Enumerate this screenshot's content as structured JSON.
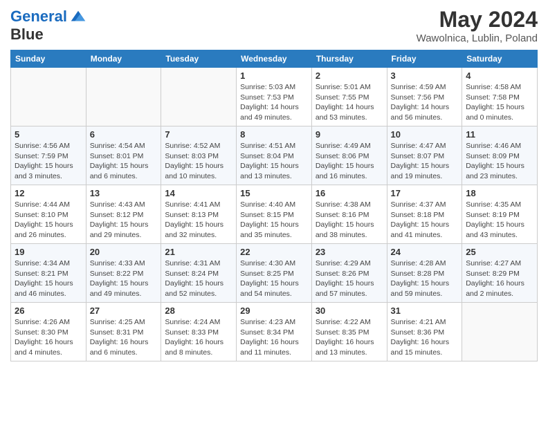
{
  "header": {
    "logo_line1": "General",
    "logo_line2": "Blue",
    "month": "May 2024",
    "location": "Wawolnica, Lublin, Poland"
  },
  "weekdays": [
    "Sunday",
    "Monday",
    "Tuesday",
    "Wednesday",
    "Thursday",
    "Friday",
    "Saturday"
  ],
  "weeks": [
    [
      {
        "day": "",
        "info": ""
      },
      {
        "day": "",
        "info": ""
      },
      {
        "day": "",
        "info": ""
      },
      {
        "day": "1",
        "info": "Sunrise: 5:03 AM\nSunset: 7:53 PM\nDaylight: 14 hours and 49 minutes."
      },
      {
        "day": "2",
        "info": "Sunrise: 5:01 AM\nSunset: 7:55 PM\nDaylight: 14 hours and 53 minutes."
      },
      {
        "day": "3",
        "info": "Sunrise: 4:59 AM\nSunset: 7:56 PM\nDaylight: 14 hours and 56 minutes."
      },
      {
        "day": "4",
        "info": "Sunrise: 4:58 AM\nSunset: 7:58 PM\nDaylight: 15 hours and 0 minutes."
      }
    ],
    [
      {
        "day": "5",
        "info": "Sunrise: 4:56 AM\nSunset: 7:59 PM\nDaylight: 15 hours and 3 minutes."
      },
      {
        "day": "6",
        "info": "Sunrise: 4:54 AM\nSunset: 8:01 PM\nDaylight: 15 hours and 6 minutes."
      },
      {
        "day": "7",
        "info": "Sunrise: 4:52 AM\nSunset: 8:03 PM\nDaylight: 15 hours and 10 minutes."
      },
      {
        "day": "8",
        "info": "Sunrise: 4:51 AM\nSunset: 8:04 PM\nDaylight: 15 hours and 13 minutes."
      },
      {
        "day": "9",
        "info": "Sunrise: 4:49 AM\nSunset: 8:06 PM\nDaylight: 15 hours and 16 minutes."
      },
      {
        "day": "10",
        "info": "Sunrise: 4:47 AM\nSunset: 8:07 PM\nDaylight: 15 hours and 19 minutes."
      },
      {
        "day": "11",
        "info": "Sunrise: 4:46 AM\nSunset: 8:09 PM\nDaylight: 15 hours and 23 minutes."
      }
    ],
    [
      {
        "day": "12",
        "info": "Sunrise: 4:44 AM\nSunset: 8:10 PM\nDaylight: 15 hours and 26 minutes."
      },
      {
        "day": "13",
        "info": "Sunrise: 4:43 AM\nSunset: 8:12 PM\nDaylight: 15 hours and 29 minutes."
      },
      {
        "day": "14",
        "info": "Sunrise: 4:41 AM\nSunset: 8:13 PM\nDaylight: 15 hours and 32 minutes."
      },
      {
        "day": "15",
        "info": "Sunrise: 4:40 AM\nSunset: 8:15 PM\nDaylight: 15 hours and 35 minutes."
      },
      {
        "day": "16",
        "info": "Sunrise: 4:38 AM\nSunset: 8:16 PM\nDaylight: 15 hours and 38 minutes."
      },
      {
        "day": "17",
        "info": "Sunrise: 4:37 AM\nSunset: 8:18 PM\nDaylight: 15 hours and 41 minutes."
      },
      {
        "day": "18",
        "info": "Sunrise: 4:35 AM\nSunset: 8:19 PM\nDaylight: 15 hours and 43 minutes."
      }
    ],
    [
      {
        "day": "19",
        "info": "Sunrise: 4:34 AM\nSunset: 8:21 PM\nDaylight: 15 hours and 46 minutes."
      },
      {
        "day": "20",
        "info": "Sunrise: 4:33 AM\nSunset: 8:22 PM\nDaylight: 15 hours and 49 minutes."
      },
      {
        "day": "21",
        "info": "Sunrise: 4:31 AM\nSunset: 8:24 PM\nDaylight: 15 hours and 52 minutes."
      },
      {
        "day": "22",
        "info": "Sunrise: 4:30 AM\nSunset: 8:25 PM\nDaylight: 15 hours and 54 minutes."
      },
      {
        "day": "23",
        "info": "Sunrise: 4:29 AM\nSunset: 8:26 PM\nDaylight: 15 hours and 57 minutes."
      },
      {
        "day": "24",
        "info": "Sunrise: 4:28 AM\nSunset: 8:28 PM\nDaylight: 15 hours and 59 minutes."
      },
      {
        "day": "25",
        "info": "Sunrise: 4:27 AM\nSunset: 8:29 PM\nDaylight: 16 hours and 2 minutes."
      }
    ],
    [
      {
        "day": "26",
        "info": "Sunrise: 4:26 AM\nSunset: 8:30 PM\nDaylight: 16 hours and 4 minutes."
      },
      {
        "day": "27",
        "info": "Sunrise: 4:25 AM\nSunset: 8:31 PM\nDaylight: 16 hours and 6 minutes."
      },
      {
        "day": "28",
        "info": "Sunrise: 4:24 AM\nSunset: 8:33 PM\nDaylight: 16 hours and 8 minutes."
      },
      {
        "day": "29",
        "info": "Sunrise: 4:23 AM\nSunset: 8:34 PM\nDaylight: 16 hours and 11 minutes."
      },
      {
        "day": "30",
        "info": "Sunrise: 4:22 AM\nSunset: 8:35 PM\nDaylight: 16 hours and 13 minutes."
      },
      {
        "day": "31",
        "info": "Sunrise: 4:21 AM\nSunset: 8:36 PM\nDaylight: 16 hours and 15 minutes."
      },
      {
        "day": "",
        "info": ""
      }
    ]
  ]
}
